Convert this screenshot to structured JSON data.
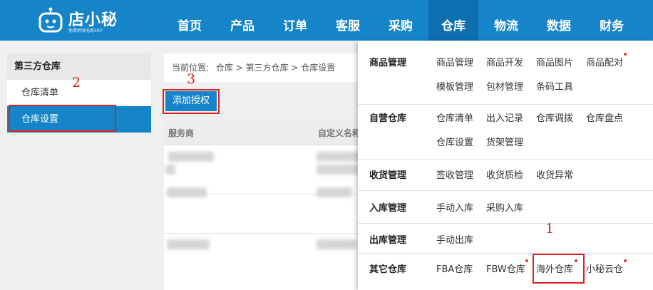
{
  "brand": {
    "name": "店小秘",
    "tagline": "免费跨境电商ERP"
  },
  "nav": [
    "首页",
    "产品",
    "订单",
    "客服",
    "采购",
    "仓库",
    "物流",
    "数据",
    "财务"
  ],
  "sidebar": {
    "title": "第三方仓库",
    "items": [
      "仓库清单",
      "仓库设置"
    ]
  },
  "breadcrumb": {
    "prefix": "当前位置:",
    "path": "仓库 > 第三方仓库 > 仓库设置"
  },
  "actions": {
    "add_auth": "添加授权"
  },
  "table": {
    "columns": [
      "服务商",
      "自定义名称"
    ]
  },
  "menu": {
    "goods": {
      "title": "商品管理",
      "links": [
        "商品管理",
        "商品开发",
        "商品图片",
        "商品配对",
        "模板管理",
        "包材管理",
        "条码工具"
      ]
    },
    "own": {
      "title": "自营仓库",
      "links": [
        "仓库清单",
        "出入记录",
        "仓库调拨",
        "仓库盘点",
        "仓库设置",
        "货架管理"
      ]
    },
    "receive": {
      "title": "收货管理",
      "links": [
        "签收管理",
        "收货质检",
        "收货异常"
      ]
    },
    "inbound": {
      "title": "入库管理",
      "links": [
        "手动入库",
        "采购入库"
      ]
    },
    "outbound": {
      "title": "出库管理",
      "links": [
        "手动出库"
      ]
    },
    "other": {
      "title": "其它仓库",
      "links": [
        "FBA仓库",
        "FBW仓库",
        "海外仓库",
        "小秘云仓"
      ]
    }
  },
  "annotations": [
    "1",
    "2",
    "3"
  ],
  "colors": {
    "primary": "#1584c9",
    "nav_active": "#0d6eb0",
    "annotation": "#e02020",
    "badge_dot": "#e53935"
  }
}
